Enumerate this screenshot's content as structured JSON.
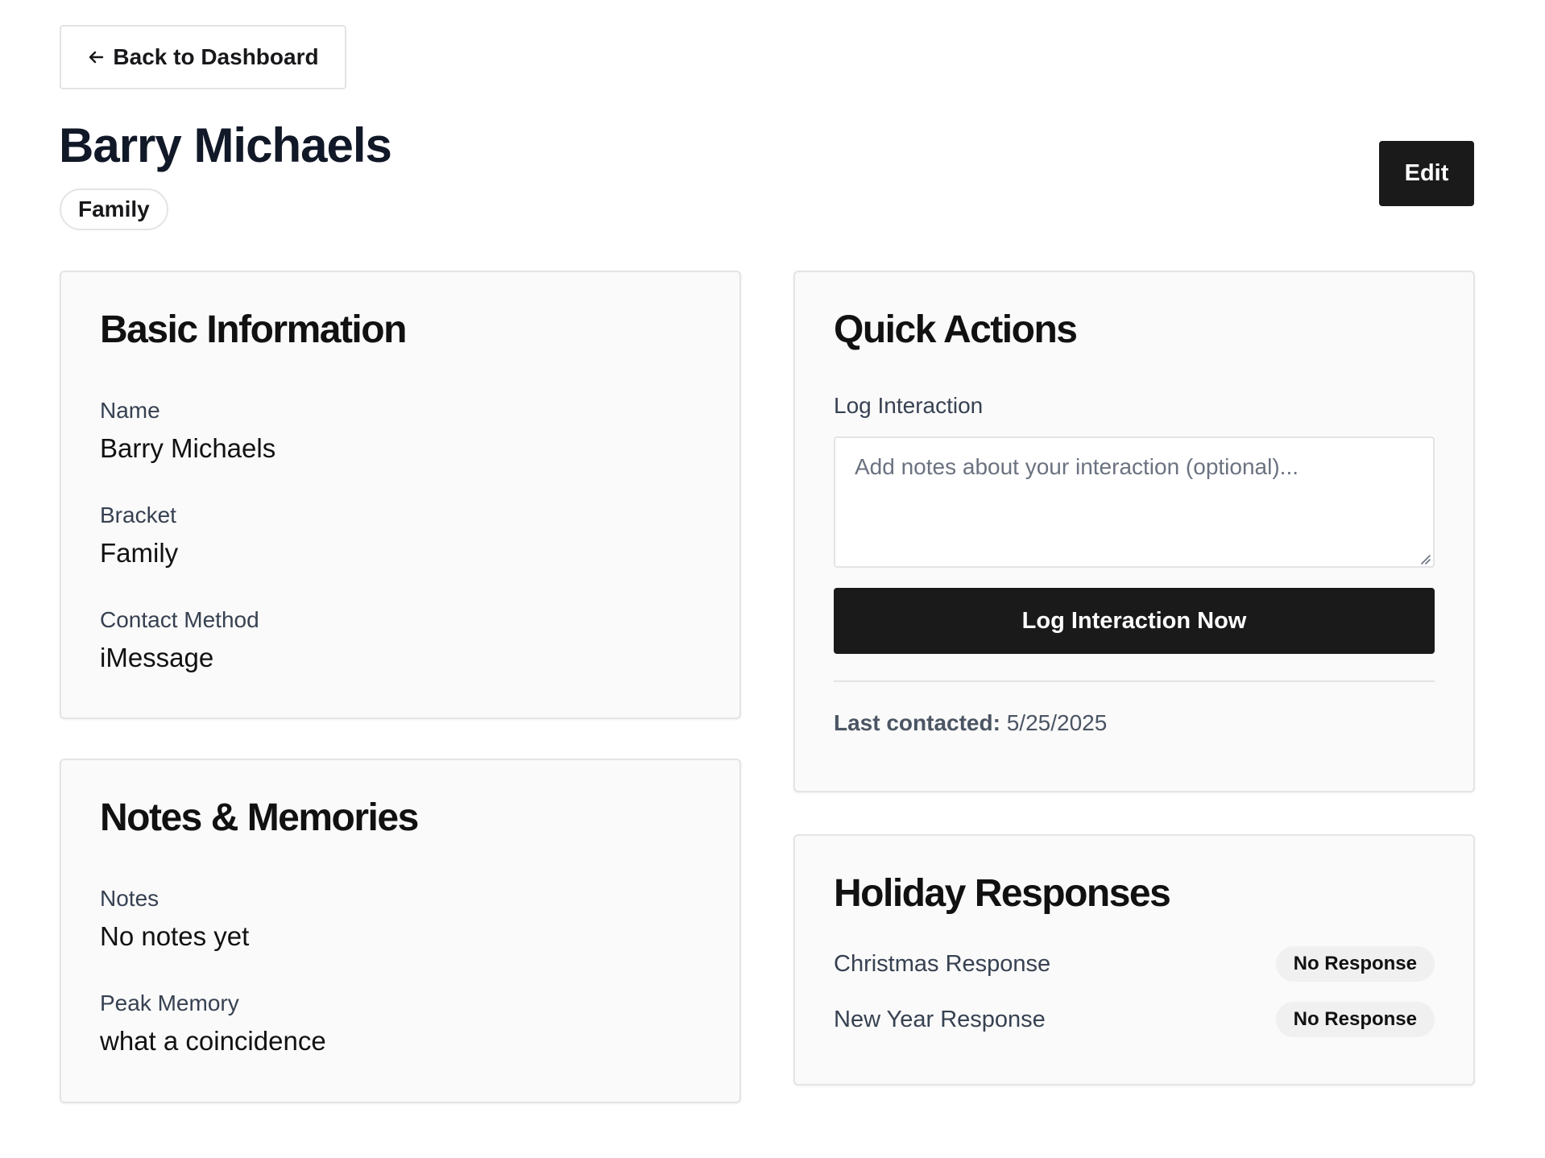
{
  "nav": {
    "back_label": "Back to Dashboard",
    "back_icon": "arrow-left-icon"
  },
  "header": {
    "title": "Barry Michaels",
    "bracket_badge": "Family",
    "edit_label": "Edit"
  },
  "basic_info": {
    "title": "Basic Information",
    "fields": [
      {
        "label": "Name",
        "value": "Barry Michaels"
      },
      {
        "label": "Bracket",
        "value": "Family"
      },
      {
        "label": "Contact Method",
        "value": "iMessage"
      }
    ]
  },
  "notes_memories": {
    "title": "Notes & Memories",
    "fields": [
      {
        "label": "Notes",
        "value": "No notes yet"
      },
      {
        "label": "Peak Memory",
        "value": "what a coincidence"
      }
    ]
  },
  "quick_actions": {
    "title": "Quick Actions",
    "log_label": "Log Interaction",
    "notes_placeholder": "Add notes about your interaction (optional)...",
    "notes_value": "",
    "log_button_label": "Log Interaction Now",
    "last_contacted_label": "Last contacted:",
    "last_contacted_value": "5/25/2025"
  },
  "holiday_responses": {
    "title": "Holiday Responses",
    "rows": [
      {
        "label": "Christmas Response",
        "status": "No Response"
      },
      {
        "label": "New Year Response",
        "status": "No Response"
      }
    ]
  },
  "colors": {
    "primary_button": "#1a1a1a",
    "card_background": "#fafafa",
    "border": "#e4e4e7",
    "badge_background": "#f0f0f0"
  }
}
